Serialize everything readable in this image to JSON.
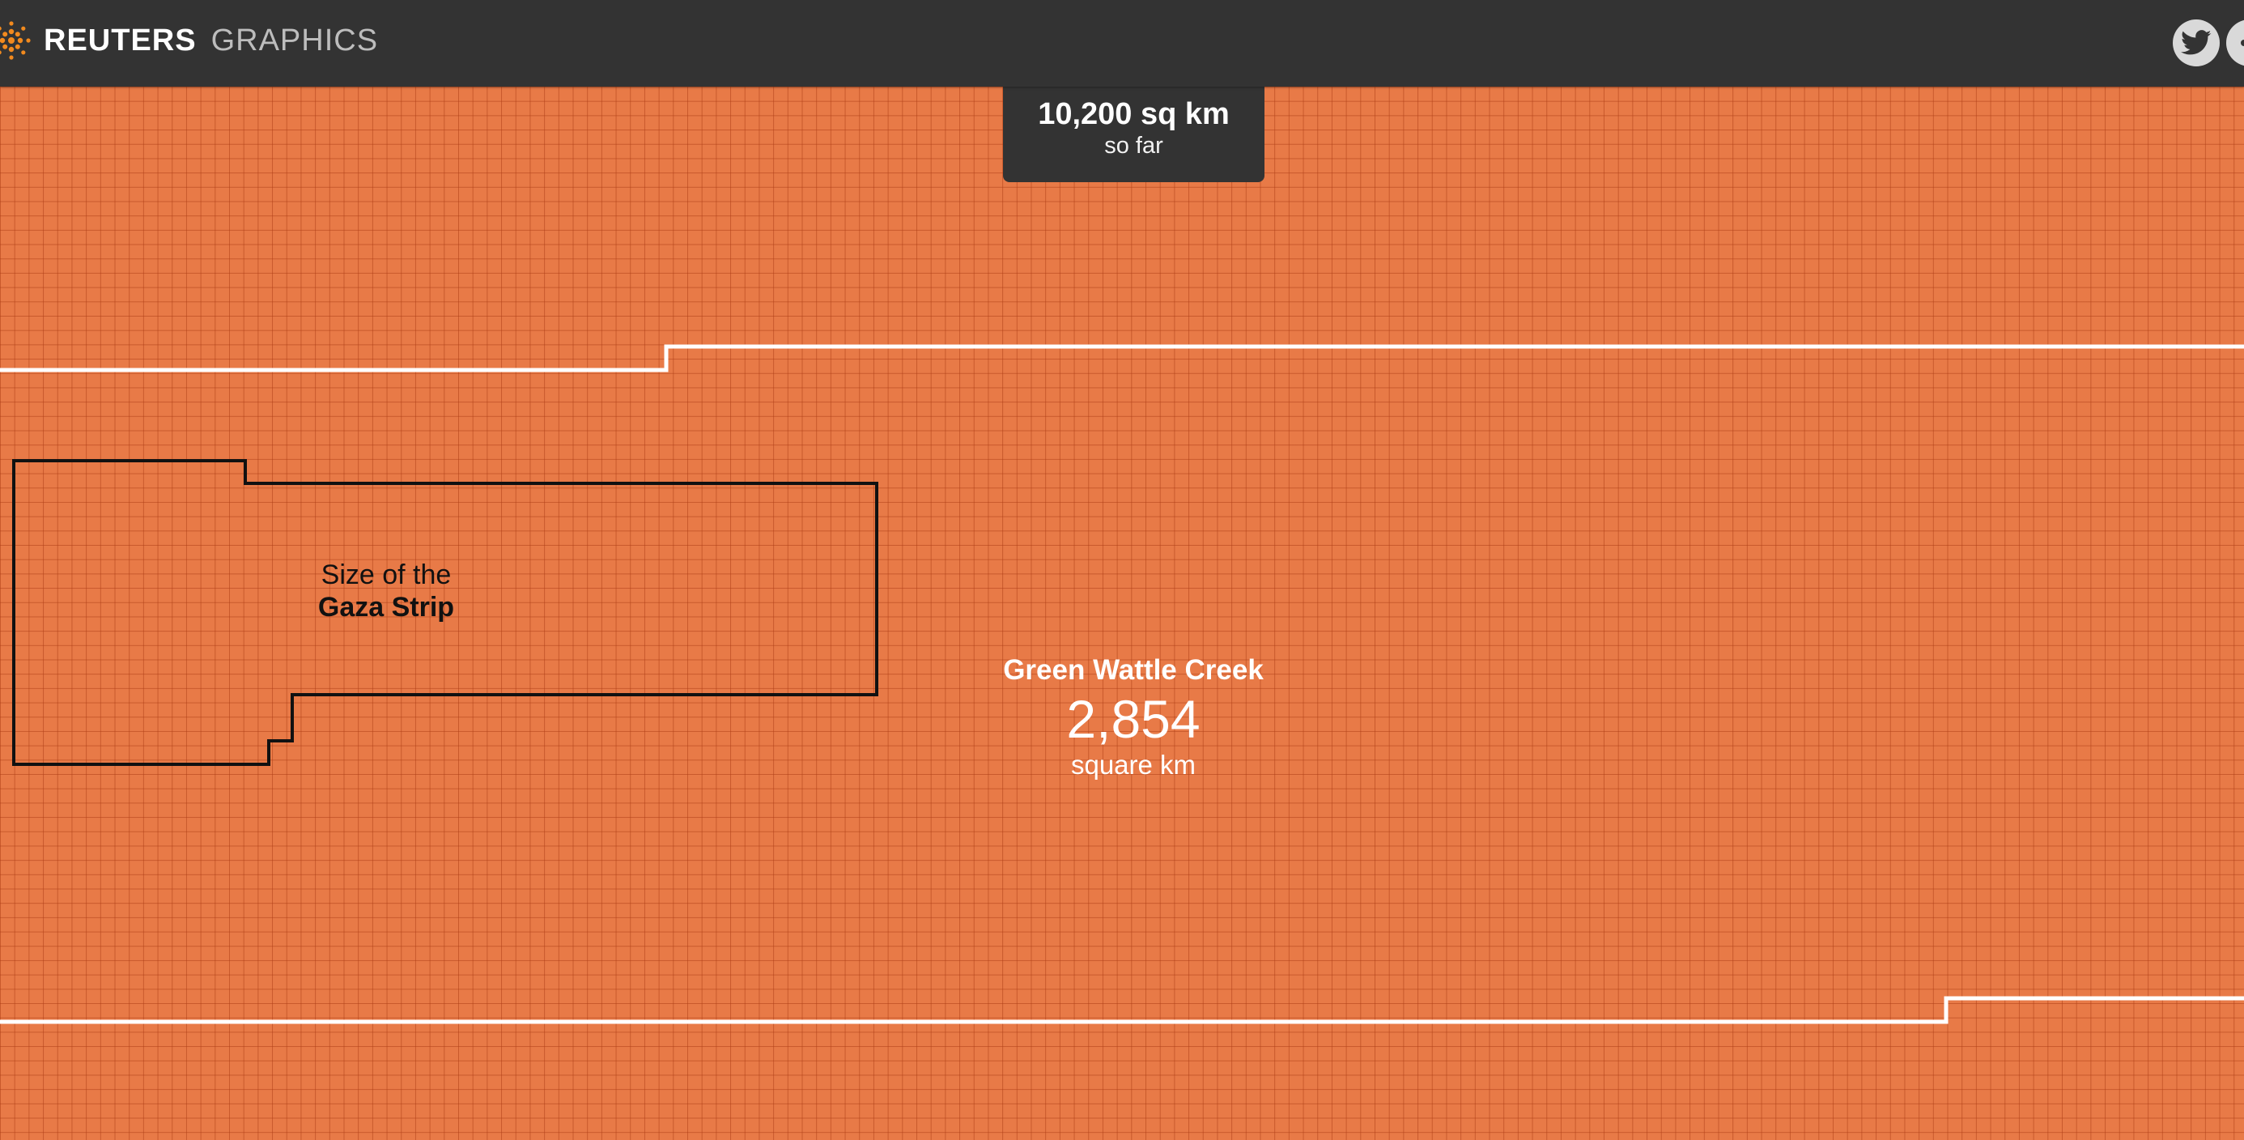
{
  "header": {
    "brand_name": "REUTERS",
    "section_name": "GRAPHICS",
    "social": [
      {
        "name": "twitter",
        "icon": "twitter-bird-icon"
      },
      {
        "name": "share",
        "icon": "share-icon"
      }
    ]
  },
  "counter": {
    "value": "10,200 sq km",
    "caption": "so far"
  },
  "comparison": {
    "line1": "Size of the",
    "line2": "Gaza Strip"
  },
  "fire": {
    "name": "Green Wattle Creek",
    "area": "2,854",
    "unit": "square km"
  },
  "colors": {
    "header_background": "#333333",
    "burn_area": "#e87a47",
    "grid_lines": "#af3e16",
    "fire_boundary": "#ffffff",
    "comparison_outline": "#111111"
  }
}
